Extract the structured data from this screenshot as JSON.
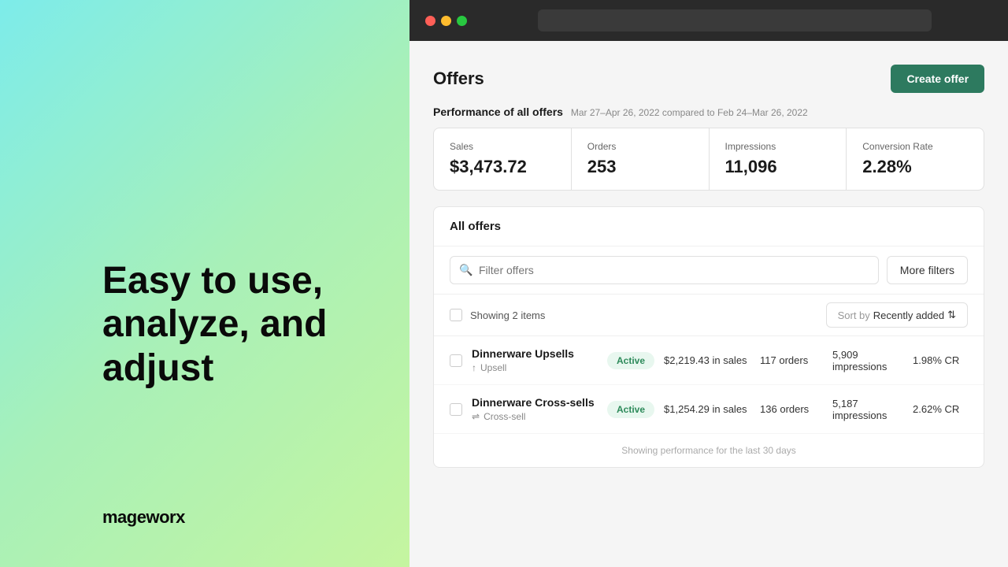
{
  "left": {
    "headline": "Easy to use, analyze, and adjust",
    "brand": "mageworx"
  },
  "browser": {
    "address_bar_placeholder": ""
  },
  "page": {
    "title": "Offers",
    "create_offer_label": "Create offer"
  },
  "performance": {
    "label": "Performance of all offers",
    "date_range": "Mar 27–Apr 26, 2022 compared to Feb 24–Mar 26, 2022",
    "stats": [
      {
        "label": "Sales",
        "value": "$3,473.72"
      },
      {
        "label": "Orders",
        "value": "253"
      },
      {
        "label": "Impressions",
        "value": "11,096"
      },
      {
        "label": "Conversion Rate",
        "value": "2.28%"
      }
    ]
  },
  "all_offers": {
    "title": "All offers",
    "search_placeholder": "Filter offers",
    "more_filters_label": "More filters",
    "showing_text": "Showing 2 items",
    "sort_label": "Sort by",
    "sort_value": "Recently added",
    "offers": [
      {
        "name": "Dinnerware Upsells",
        "type": "Upsell",
        "type_icon": "↑",
        "status": "Active",
        "sales": "$2,219.43 in sales",
        "orders": "117 orders",
        "impressions": "5,909 impressions",
        "cr": "1.98% CR"
      },
      {
        "name": "Dinnerware Cross-sells",
        "type": "Cross-sell",
        "type_icon": "⇌",
        "status": "Active",
        "sales": "$1,254.29 in sales",
        "orders": "136 orders",
        "impressions": "5,187 impressions",
        "cr": "2.62% CR"
      }
    ],
    "footer_note": "Showing performance for the last 30 days"
  }
}
